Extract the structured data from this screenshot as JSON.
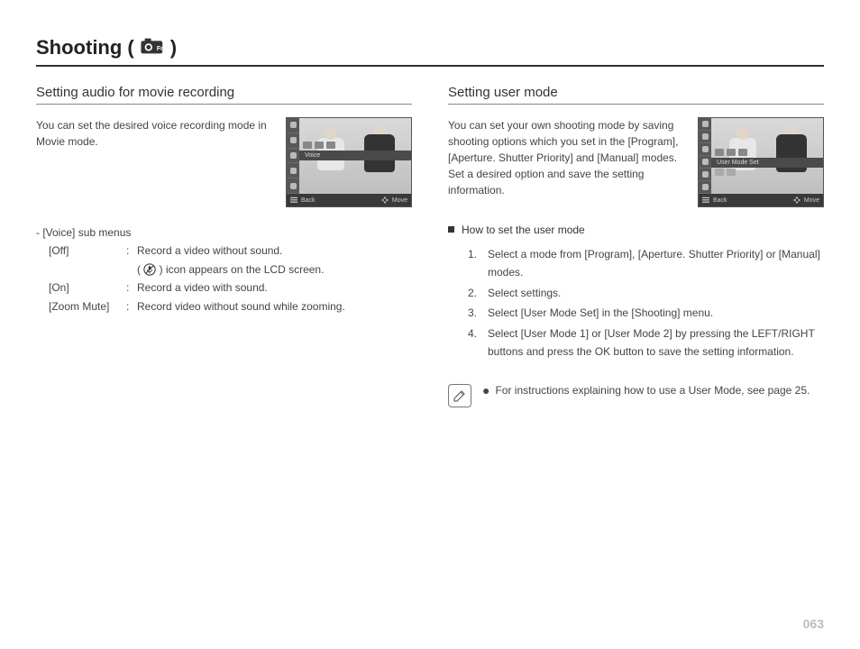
{
  "title": {
    "prefix": "Shooting (",
    "suffix": ")",
    "icon": "camera-fn-icon"
  },
  "left": {
    "heading": "Setting audio for movie recording",
    "intro": "You can set the desired voice recording mode in Movie mode.",
    "lcd": {
      "strap_label": "Voice",
      "back_label": "Back",
      "move_label": "Move"
    },
    "submenus": {
      "title": "- [Voice] sub menus",
      "items": [
        {
          "key": "[Off]",
          "value": "Record a video without sound."
        },
        {
          "key": "",
          "value_prefix": " ( ",
          "value_suffix": " ) icon appears on the LCD screen.",
          "has_icon": true
        },
        {
          "key": "[On]",
          "value": "Record a video with sound."
        },
        {
          "key": "[Zoom Mute]",
          "value": "Record video without sound while zooming."
        }
      ]
    }
  },
  "right": {
    "heading": "Setting user mode",
    "intro": "You can set your own shooting mode by saving shooting options which you set in the [Program], [Aperture. Shutter Priority] and [Manual] modes.\nSet a desired option and save the setting information.",
    "lcd": {
      "strap_label": "User Mode Set",
      "back_label": "Back",
      "move_label": "Move"
    },
    "howto_title": "How to set the user mode",
    "steps": [
      "Select a mode from [Program], [Aperture. Shutter Priority] or [Manual] modes.",
      "Select settings.",
      "Select [User Mode Set] in the [Shooting] menu.",
      "Select [User Mode 1] or [User Mode 2] by pressing the LEFT/RIGHT buttons and press the OK button to save the setting information."
    ],
    "note": "For instructions explaining how to use a User Mode, see page 25."
  },
  "page_number": "063"
}
